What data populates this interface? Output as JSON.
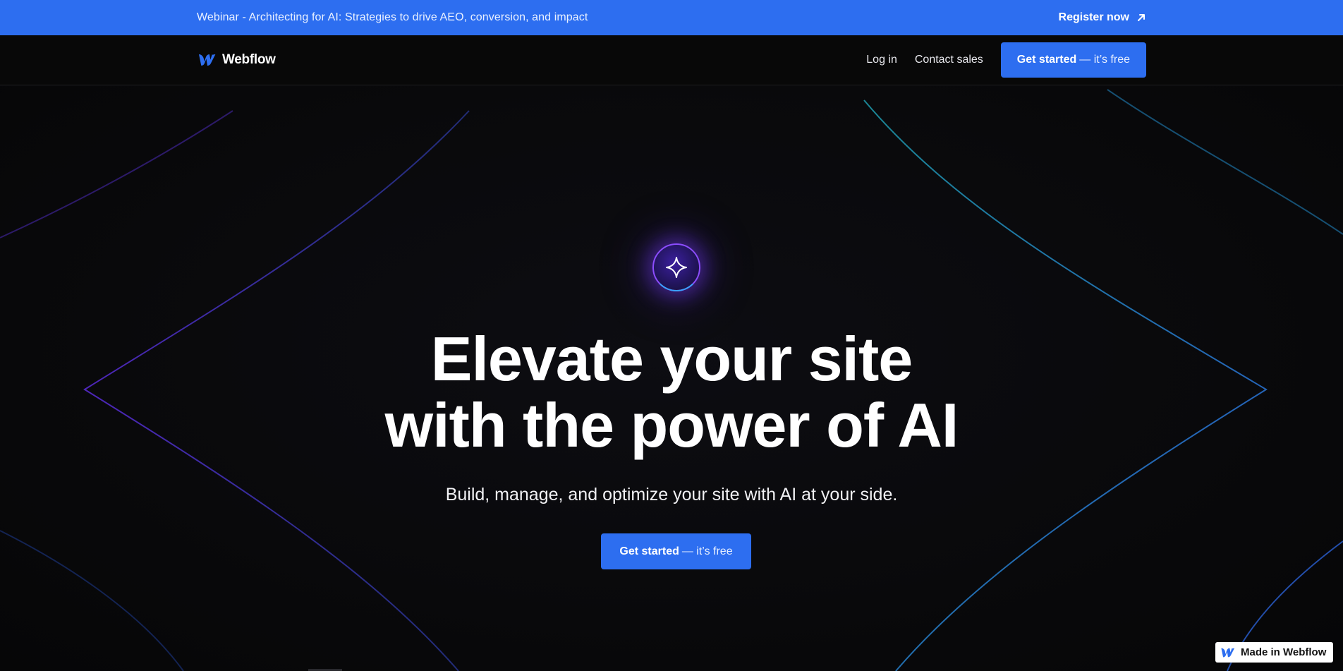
{
  "banner": {
    "text": "Webinar - Architecting for AI: Strategies to drive AEO, conversion, and impact",
    "cta_label": "Register now",
    "cta_icon": "arrow-up-right-icon"
  },
  "nav": {
    "logo_text": "Webflow",
    "logo_icon": "webflow-logo-icon",
    "login_label": "Log in",
    "contact_label": "Contact sales",
    "cta_strong": "Get started",
    "cta_light": "— it’s free"
  },
  "hero": {
    "icon": "sparkle-icon",
    "title_line1": "Elevate your site",
    "title_line2": "with the power of AI",
    "subtitle": "Build, manage, and optimize your site with AI at your side.",
    "cta_strong": "Get started",
    "cta_light": "— it’s free"
  },
  "badge": {
    "label": "Made in Webflow",
    "icon": "webflow-logo-icon"
  },
  "colors": {
    "brand_blue": "#2d6ef0",
    "background": "#0a0a0c",
    "accent_purple": "#8c4dff",
    "accent_cyan": "#3aa0ff"
  }
}
